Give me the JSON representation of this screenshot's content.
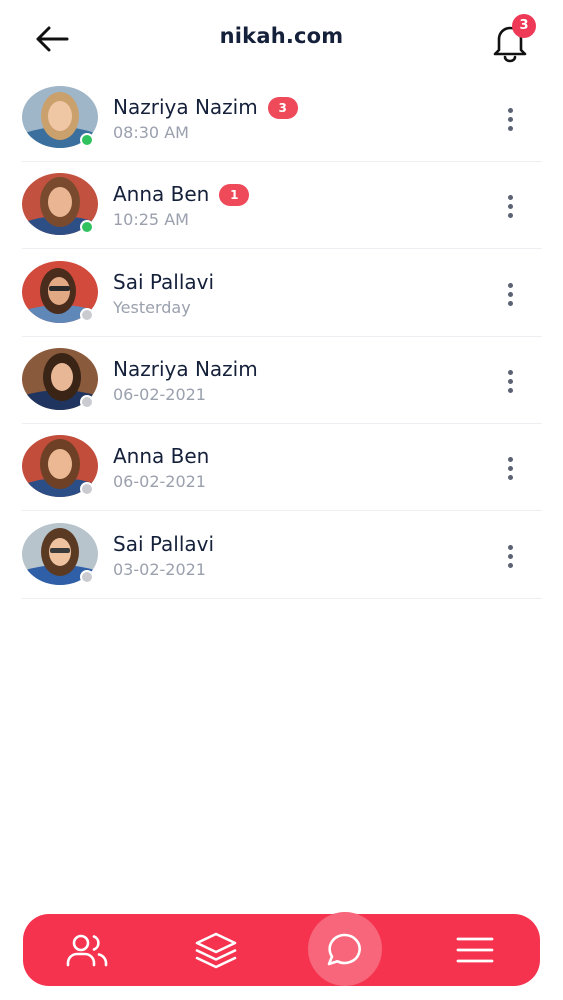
{
  "header": {
    "title": "nikah.com",
    "back_icon": "arrow-left-icon",
    "bell_icon": "bell-icon",
    "notification_count": "3"
  },
  "colors": {
    "accent": "#f5334f",
    "badge": "#ee4a5a",
    "online": "#2fc25f",
    "offline": "#c9cbd1",
    "text": "#15203a",
    "muted": "#9aa0ad"
  },
  "chats": [
    {
      "name": "Nazriya Nazim",
      "time": "08:30 AM",
      "unread": "3",
      "status": "online"
    },
    {
      "name": "Anna Ben",
      "time": "10:25 AM",
      "unread": "1",
      "status": "online"
    },
    {
      "name": "Sai Pallavi",
      "time": "Yesterday",
      "unread": "",
      "status": "offline"
    },
    {
      "name": "Nazriya Nazim",
      "time": "06-02-2021",
      "unread": "",
      "status": "offline"
    },
    {
      "name": "Anna Ben",
      "time": "06-02-2021",
      "unread": "",
      "status": "offline"
    },
    {
      "name": "Sai Pallavi",
      "time": "03-02-2021",
      "unread": "",
      "status": "offline"
    }
  ],
  "bottom_nav": {
    "items": [
      {
        "icon": "users-icon",
        "active": false
      },
      {
        "icon": "layers-icon",
        "active": false
      },
      {
        "icon": "chat-icon",
        "active": true
      },
      {
        "icon": "menu-icon",
        "active": false
      }
    ]
  }
}
